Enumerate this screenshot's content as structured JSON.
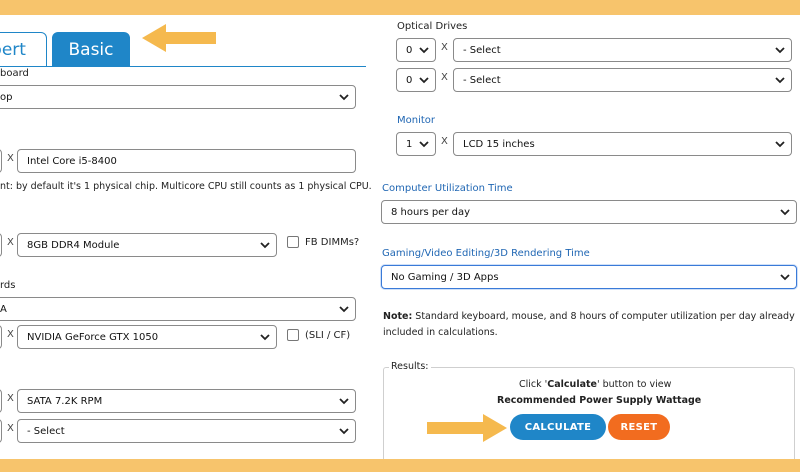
{
  "tabs": {
    "expert": "pert",
    "basic": "Basic"
  },
  "left": {
    "motherboard_label": "board",
    "motherboard_value": "op",
    "cpu_qty": "",
    "cpu_x": "X",
    "cpu_value": "Intel Core i5-8400",
    "cpu_note": "nt: by default it's 1 physical chip. Multicore CPU still counts as 1 physical CPU.",
    "memory_x": "X",
    "memory_value": "8GB DDR4 Module",
    "fb_dimms_label": "FB DIMMs?",
    "video_label": "rds",
    "video_brand_value": "A",
    "video_x": "X",
    "video_value": "NVIDIA GeForce GTX 1050",
    "sli_label": "(SLI / CF)",
    "storage1_x": "X",
    "storage1_value": "SATA 7.2K RPM",
    "storage2_x": "X",
    "storage2_value": "- Select"
  },
  "right": {
    "optical_label": "Optical Drives",
    "optical_rows": [
      {
        "qty": "0",
        "x": "X",
        "value": "- Select"
      },
      {
        "qty": "0",
        "x": "X",
        "value": "- Select"
      }
    ],
    "monitor_label": "Monitor",
    "monitor_qty": "1",
    "monitor_x": "X",
    "monitor_value": "LCD 15 inches",
    "util_label": "Computer Utilization Time",
    "util_value": "8 hours per day",
    "gaming_label": "Gaming/Video Editing/3D Rendering Time",
    "gaming_value": "No Gaming / 3D Apps",
    "note_bold": "Note:",
    "note_line1": " Standard keyboard, mouse, and 8 hours of computer utilization per day already",
    "note_line2": "included in calculations.",
    "results_legend": "Results:",
    "results_line1_pre": "Click '",
    "results_line1_bold": "Calculate",
    "results_line1_post": "' button to view",
    "results_line2": "Recommended Power Supply Wattage",
    "calculate_label": "CALCULATE",
    "reset_label": "RESET"
  },
  "colors": {
    "accent": "#1f86c8",
    "reset": "#f26c1f",
    "annotation_arrow": "#f5b94e",
    "frame": "#f7c46c"
  }
}
